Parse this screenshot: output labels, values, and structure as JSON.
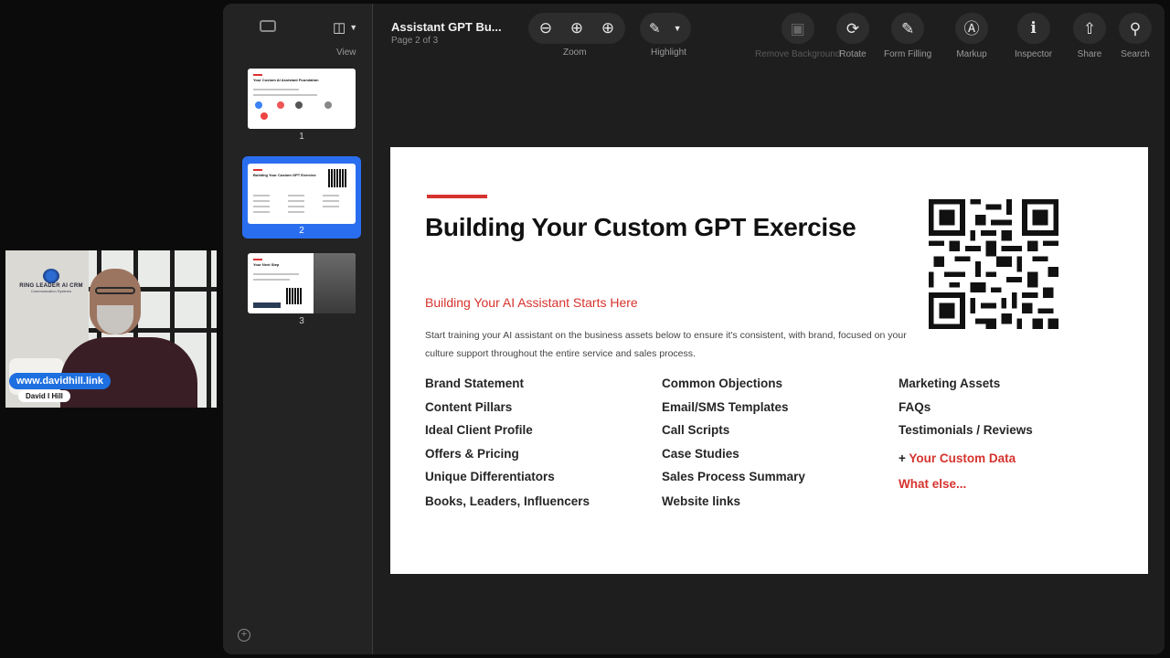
{
  "webcam": {
    "brand": "RING LEADER AI CRM",
    "brand_sub": "Communication Systems",
    "link": "www.davidhill.link",
    "name": "David I Hill"
  },
  "toolbar": {
    "view_label": "View",
    "doc_title": "Assistant GPT Bu...",
    "page_indicator": "Page 2 of 3",
    "zoom_label": "Zoom",
    "highlight_label": "Highlight",
    "remove_bg_label": "Remove Background",
    "rotate_label": "Rotate",
    "form_label": "Form Filling",
    "markup_label": "Markup",
    "inspector_label": "Inspector",
    "share_label": "Share",
    "search_label": "Search"
  },
  "thumbnails": [
    {
      "num": "1",
      "title": "Your Custom AI Assistant Foundation"
    },
    {
      "num": "2",
      "title": "Building Your Custom GPT Exercise"
    },
    {
      "num": "3",
      "title": "Your Next Step"
    }
  ],
  "slide": {
    "title": "Building Your Custom GPT Exercise",
    "subtitle": "Building Your AI Assistant Starts Here",
    "description": "Start training your AI assistant on the business assets below to ensure it's consistent, with brand, focused on your culture support throughout the entire service and sales process.",
    "col1": [
      "Brand Statement",
      "Content Pillars",
      "Ideal Client Profile",
      "Offers & Pricing",
      "Unique Differentiators",
      "Books, Leaders, Influencers"
    ],
    "col2": [
      "Common Objections",
      "Email/SMS Templates",
      "Call Scripts",
      "Case Studies",
      "Sales Process Summary",
      "Website links"
    ],
    "col3": [
      "Marketing Assets",
      "FAQs",
      "Testimonials / Reviews"
    ],
    "custom_plus": "+",
    "custom_data": "Your Custom Data",
    "what_else": "What else..."
  },
  "colors": {
    "accent_red": "#d6332e",
    "selection_blue": "#2a6ef0",
    "window_bg": "#1e1e1e"
  }
}
